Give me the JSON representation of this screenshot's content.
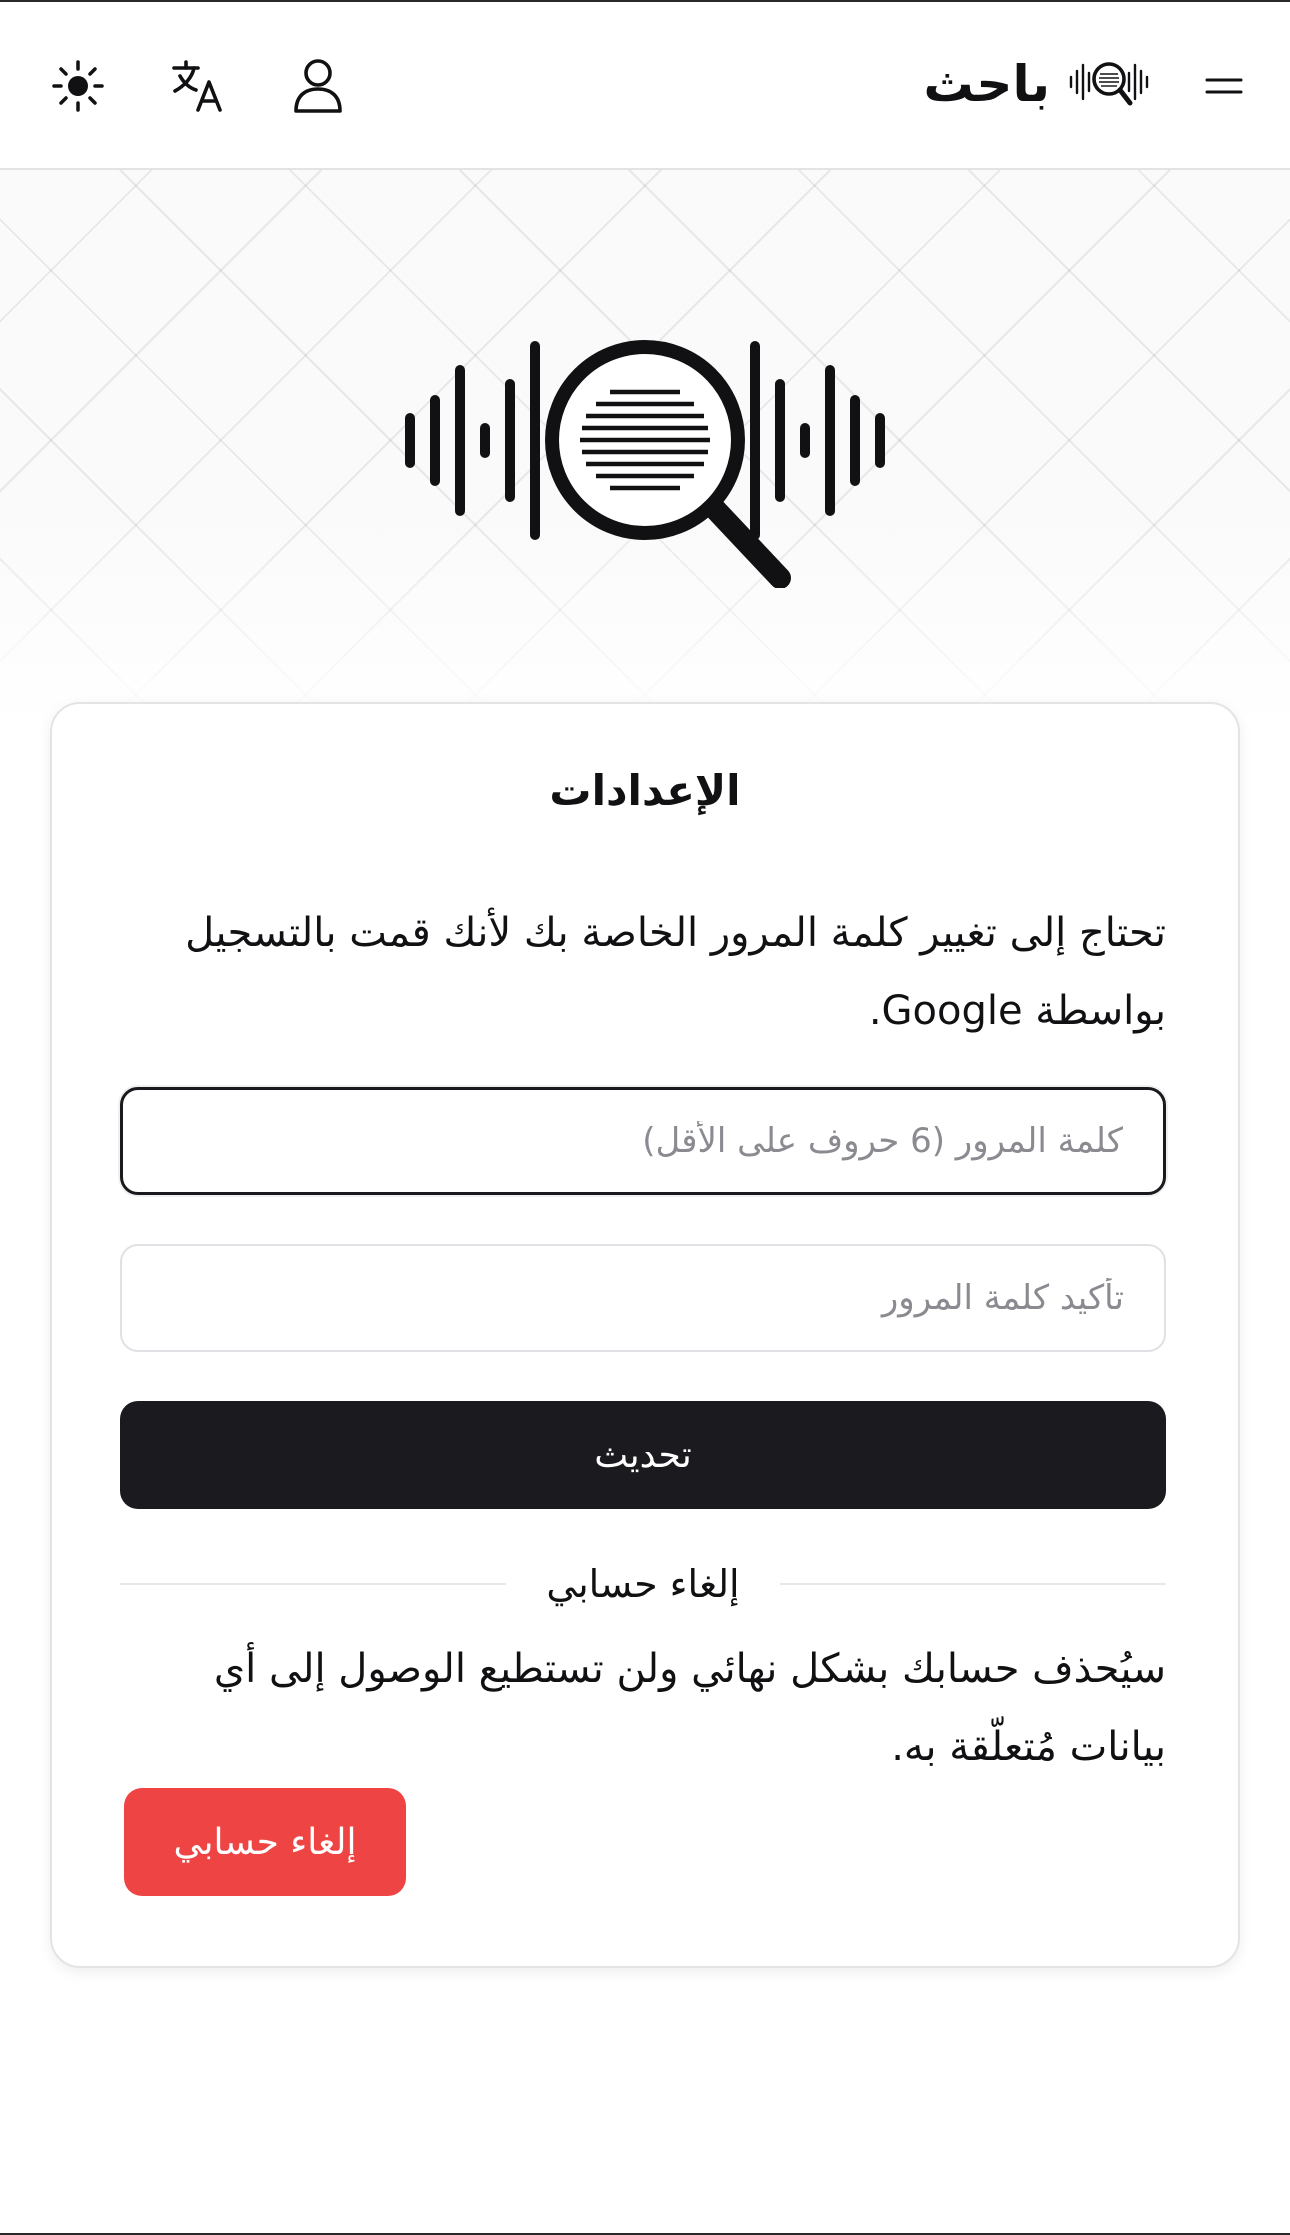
{
  "header": {
    "brand_name": "باحث",
    "icons": {
      "menu": "menu-icon",
      "logo": "waveform-magnifier-logo",
      "profile": "user-icon",
      "language": "translate-icon",
      "theme": "sun-icon"
    }
  },
  "hero": {
    "logo": "waveform-magnifier-logo"
  },
  "settings": {
    "title": "الإعدادات",
    "notice": "تحتاج إلى تغيير كلمة المرور الخاصة بك لأنك قمت بالتسجيل بواسطة Google.",
    "password_placeholder": "كلمة المرور (6 حروف على الأقل)",
    "confirm_placeholder": "تأكيد كلمة المرور",
    "update_label": "تحديث",
    "cancel_section_label": "إلغاء حسابي",
    "cancel_warning": "سيُحذف حسابك بشكل نهائي ولن تستطيع الوصول إلى أي بيانات مُتعلّقة به.",
    "cancel_button_label": "إلغاء حسابي"
  },
  "colors": {
    "primary_button": "#1b1b1f",
    "danger_button": "#ef4444",
    "text": "#111114",
    "placeholder": "#8a8a90"
  }
}
